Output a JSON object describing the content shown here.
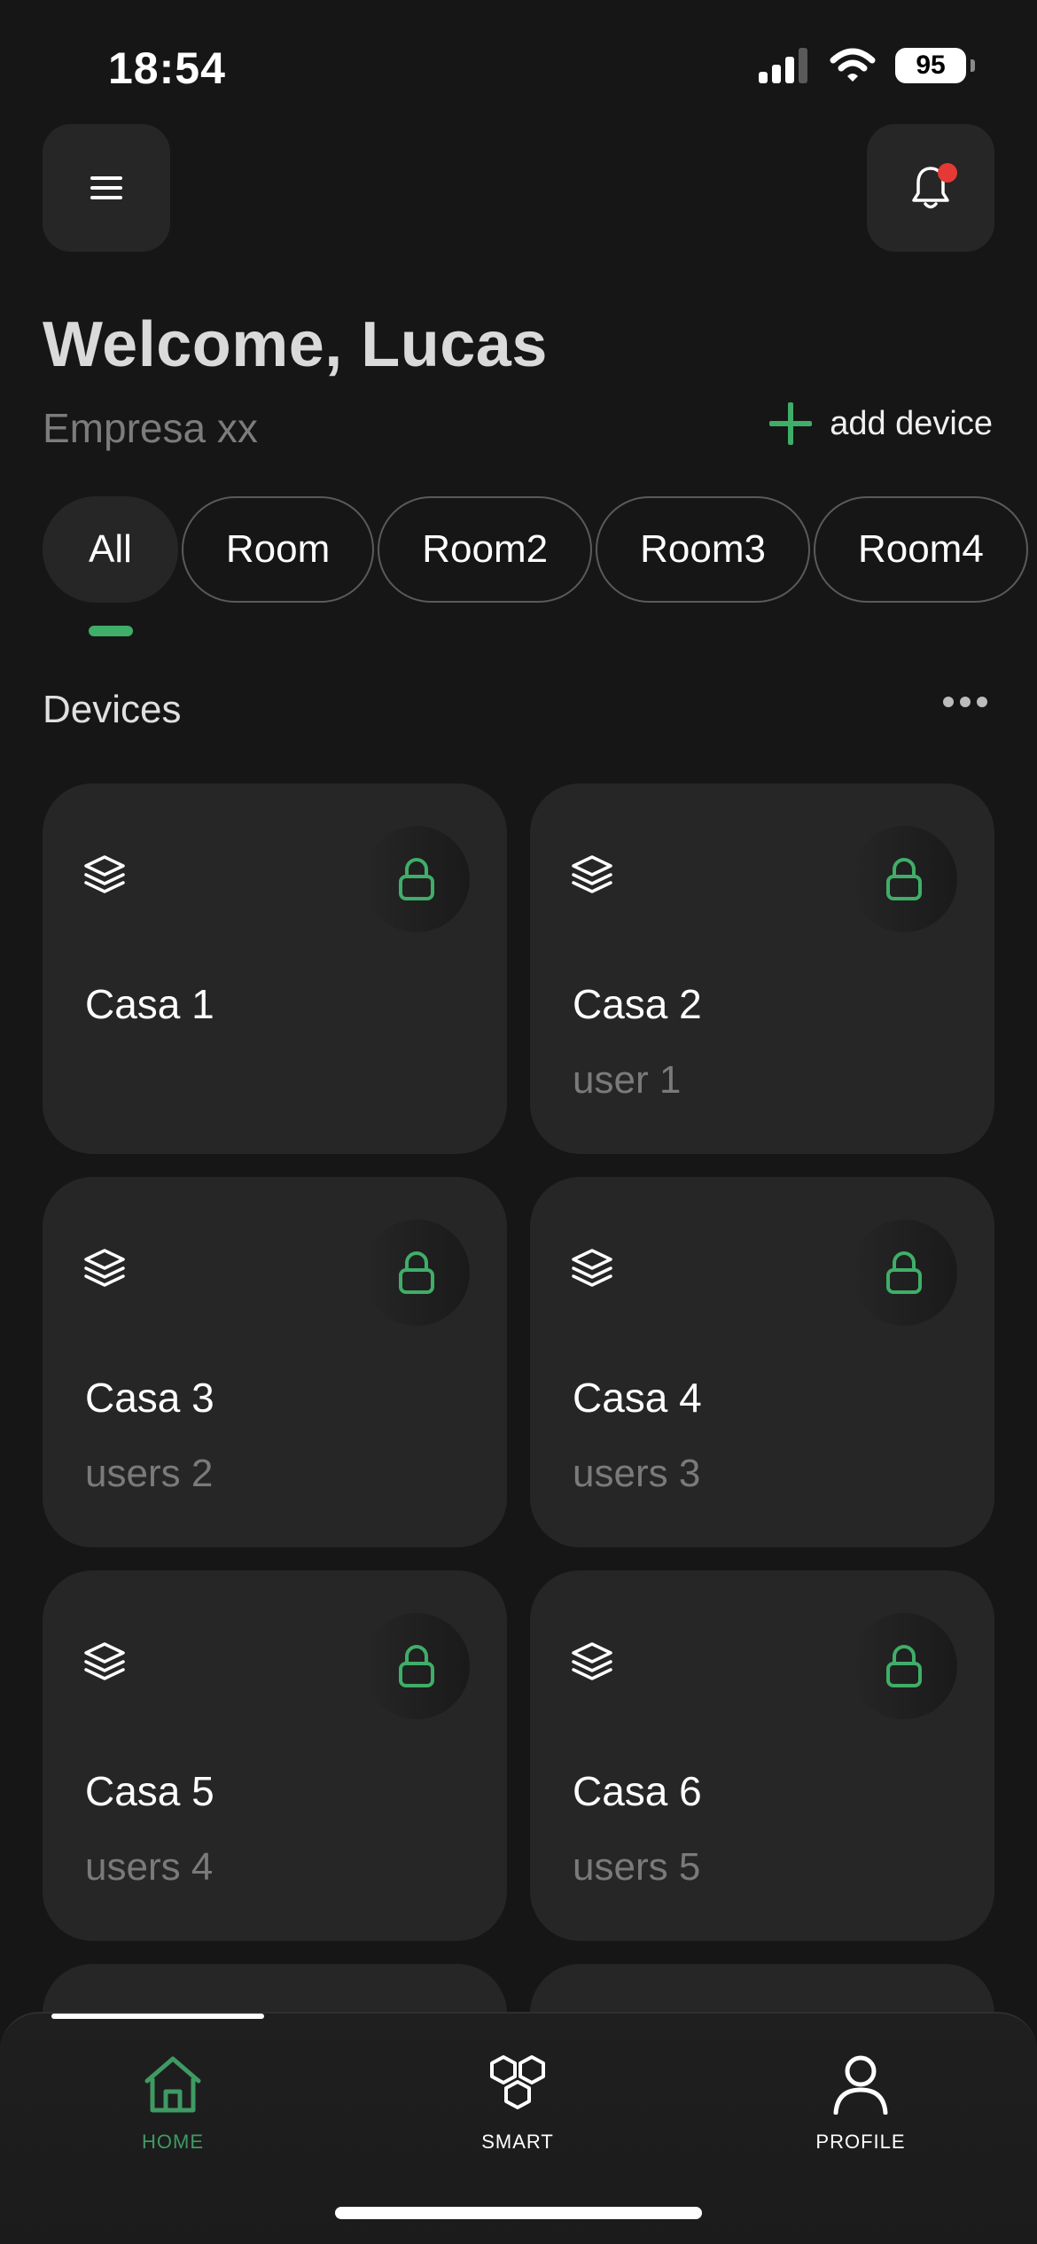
{
  "status_bar": {
    "time": "18:54",
    "battery": "95"
  },
  "header": {
    "welcome": "Welcome, Lucas",
    "company": "Empresa xx",
    "add_device_label": "add device"
  },
  "tabs": [
    {
      "label": "All",
      "active": true
    },
    {
      "label": "Room"
    },
    {
      "label": "Room2"
    },
    {
      "label": "Room3"
    },
    {
      "label": "Room4"
    }
  ],
  "devices": {
    "title": "Devices",
    "items": [
      {
        "name": "Casa 1",
        "users": ""
      },
      {
        "name": "Casa 2",
        "users": "user 1"
      },
      {
        "name": "Casa 3",
        "users": "users 2"
      },
      {
        "name": "Casa 4",
        "users": "users 3"
      },
      {
        "name": "Casa 5",
        "users": "users 4"
      },
      {
        "name": "Casa 6",
        "users": "users 5"
      }
    ]
  },
  "bottom_nav": {
    "items": [
      {
        "label": "HOME",
        "icon": "home-icon",
        "active": true
      },
      {
        "label": "SMART",
        "icon": "smart-hexagons-icon"
      },
      {
        "label": "PROFILE",
        "icon": "profile-icon"
      }
    ]
  },
  "colors": {
    "accent": "#3fae68",
    "background": "#161616",
    "card": "#262626",
    "notification": "#e53935"
  }
}
